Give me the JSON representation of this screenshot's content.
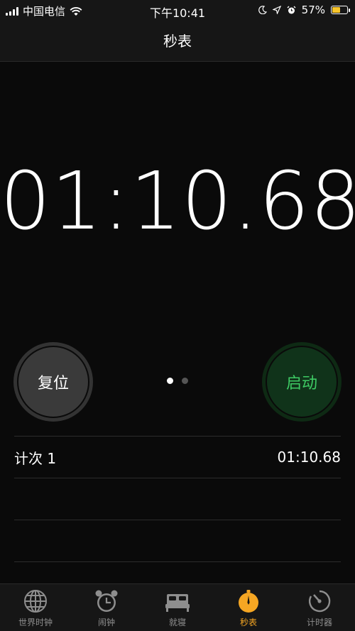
{
  "status_bar": {
    "carrier": "中国电信",
    "time": "下午10:41",
    "battery": "57%",
    "battery_level": 57,
    "battery_color": "#f7c52b"
  },
  "nav": {
    "title": "秒表"
  },
  "stopwatch": {
    "display": "01:10.68"
  },
  "buttons": {
    "reset_label": "复位",
    "start_label": "启动",
    "start_color": "#3ecb64"
  },
  "laps": [
    {
      "label": "计次 1",
      "time": "01:10.68"
    }
  ],
  "tabs": [
    {
      "label": "世界时钟",
      "icon": "globe-icon",
      "active": false
    },
    {
      "label": "闹钟",
      "icon": "alarm-clock-icon",
      "active": false
    },
    {
      "label": "就寝",
      "icon": "bed-icon",
      "active": false
    },
    {
      "label": "秒表",
      "icon": "stopwatch-icon",
      "active": true
    },
    {
      "label": "计时器",
      "icon": "timer-icon",
      "active": false
    }
  ],
  "accent_color": "#f5a623"
}
